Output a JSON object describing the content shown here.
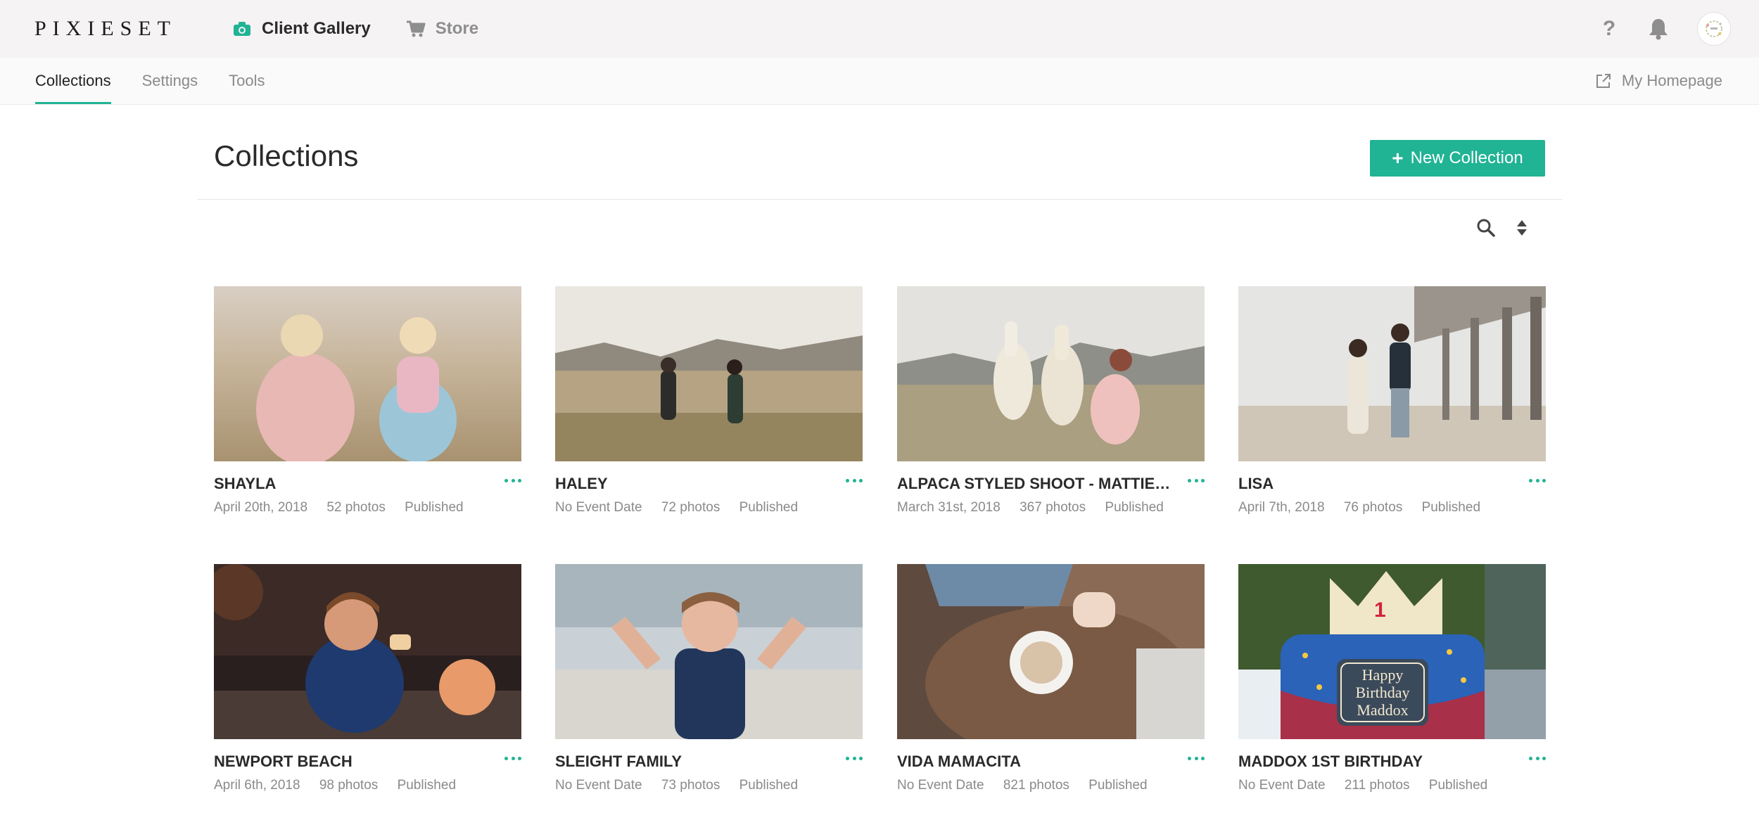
{
  "brand": {
    "logo_text": "PIXIESET"
  },
  "app_nav": [
    {
      "label": "Client Gallery",
      "icon": "camera-icon",
      "active": true
    },
    {
      "label": "Store",
      "icon": "cart-icon",
      "active": false
    }
  ],
  "top_right": {
    "help_label": "?",
    "bell_icon": "bell-icon",
    "avatar_icon": "avatar-wreath-icon"
  },
  "sub_nav": {
    "tabs": [
      {
        "label": "Collections",
        "active": true
      },
      {
        "label": "Settings",
        "active": false
      },
      {
        "label": "Tools",
        "active": false
      }
    ],
    "homepage_label": "My Homepage"
  },
  "page": {
    "title": "Collections",
    "new_button_label": "New Collection",
    "new_button_icon": "+"
  },
  "collections": [
    {
      "name": "SHAYLA",
      "date": "April 20th, 2018",
      "photos": "52 photos",
      "status": "Published"
    },
    {
      "name": "HALEY",
      "date": "No Event Date",
      "photos": "72 photos",
      "status": "Published"
    },
    {
      "name": "ALPACA STYLED SHOOT - MATTIE …",
      "date": "March 31st, 2018",
      "photos": "367 photos",
      "status": "Published"
    },
    {
      "name": "LISA",
      "date": "April 7th, 2018",
      "photos": "76 photos",
      "status": "Published"
    },
    {
      "name": "NEWPORT BEACH",
      "date": "April 6th, 2018",
      "photos": "98 photos",
      "status": "Published"
    },
    {
      "name": "SLEIGHT FAMILY",
      "date": "No Event Date",
      "photos": "73 photos",
      "status": "Published"
    },
    {
      "name": "VIDA MAMACITA",
      "date": "No Event Date",
      "photos": "821 photos",
      "status": "Published"
    },
    {
      "name": "MADDOX 1ST BIRTHDAY",
      "date": "No Event Date",
      "photos": "211 photos",
      "status": "Published"
    }
  ],
  "cake_text": {
    "line1": "Happy",
    "line2": "Birthday",
    "line3": "Maddox",
    "number": "1"
  },
  "colors": {
    "accent": "#20b394",
    "topbar": "#f5f3f4",
    "text": "#2a2a2a",
    "muted": "#8a8a8a"
  }
}
